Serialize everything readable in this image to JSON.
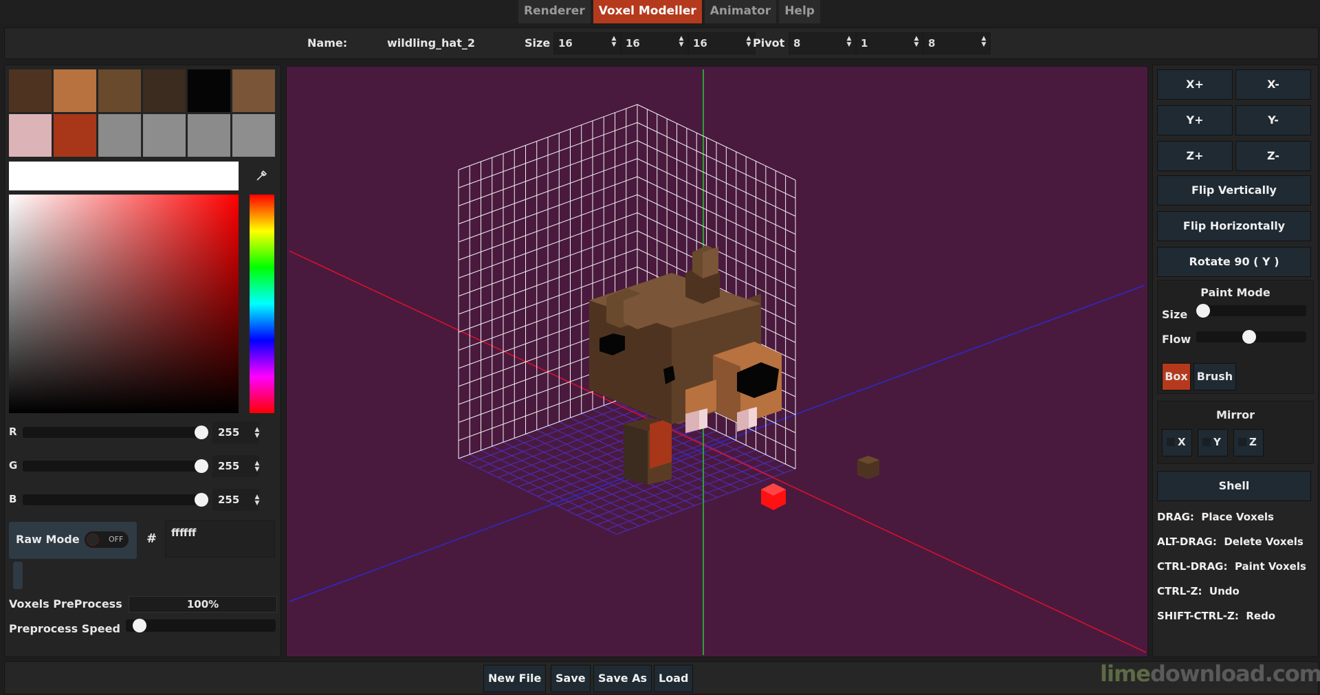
{
  "tabs": [
    {
      "label": "Renderer",
      "active": false
    },
    {
      "label": "Voxel Modeller",
      "active": true
    },
    {
      "label": "Animator",
      "active": false
    },
    {
      "label": "Help",
      "active": false
    }
  ],
  "header": {
    "name_label": "Name:",
    "name_value": "wildling_hat_2",
    "size_label": "Size",
    "size": [
      "16",
      "16",
      "16"
    ],
    "pivot_label": "Pivot",
    "pivot": [
      "8",
      "1",
      "8"
    ]
  },
  "palette": [
    "#4e3420",
    "#b8723f",
    "#6a4a2c",
    "#3c2b1f",
    "#050505",
    "#7a5537",
    "#dcb3b6",
    "#a83618",
    "#8b8b8b",
    "#8d8d8d",
    "#8b8b8b",
    "#8e8e8e"
  ],
  "color": {
    "r_label": "R",
    "r": "255",
    "g_label": "G",
    "g": "255",
    "b_label": "B",
    "b": "255",
    "raw_mode_label": "Raw Mode",
    "raw_mode_state": "OFF",
    "hash": "#",
    "hex": "ffffff"
  },
  "preprocess": {
    "voxels_label": "Voxels PreProcess",
    "voxels_value": "100%",
    "speed_label": "Preprocess Speed",
    "speed_level": 0.05
  },
  "tools": {
    "x_plus": "X+",
    "x_minus": "X-",
    "y_plus": "Y+",
    "y_minus": "Y-",
    "z_plus": "Z+",
    "z_minus": "Z-",
    "flip_v": "Flip Vertically",
    "flip_h": "Flip Horizontally",
    "rotate": "Rotate 90 ( Y )"
  },
  "paint_mode": {
    "title": "Paint Mode",
    "size_label": "Size",
    "size_level": 0.0,
    "flow_label": "Flow",
    "flow_level": 0.48,
    "box_label": "Box",
    "brush_label": "Brush",
    "selected": "Box"
  },
  "mirror": {
    "title": "Mirror",
    "x": "X",
    "y": "Y",
    "z": "Z"
  },
  "shell_label": "Shell",
  "help": [
    {
      "key": "DRAG:",
      "desc": "Place Voxels"
    },
    {
      "key": "ALT-DRAG:",
      "desc": "Delete Voxels"
    },
    {
      "key": "CTRL-DRAG:",
      "desc": "Paint Voxels"
    },
    {
      "key": "CTRL-Z:",
      "desc": "Undo"
    },
    {
      "key": "SHIFT-CTRL-Z:",
      "desc": "Redo"
    }
  ],
  "footer": {
    "new_file": "New File",
    "save": "Save",
    "save_as": "Save As",
    "load": "Load"
  },
  "watermark": {
    "part1": "lime",
    "part2": "download.com"
  },
  "viewport_colors": {
    "background": "#4a1a3e",
    "grid": "#f2f2f2",
    "floor": "#4b2bb4",
    "x_axis": "#e0102a",
    "z_axis": "#2a2acc",
    "y_axis": "#22cc33",
    "cursor": "#ff1111"
  }
}
